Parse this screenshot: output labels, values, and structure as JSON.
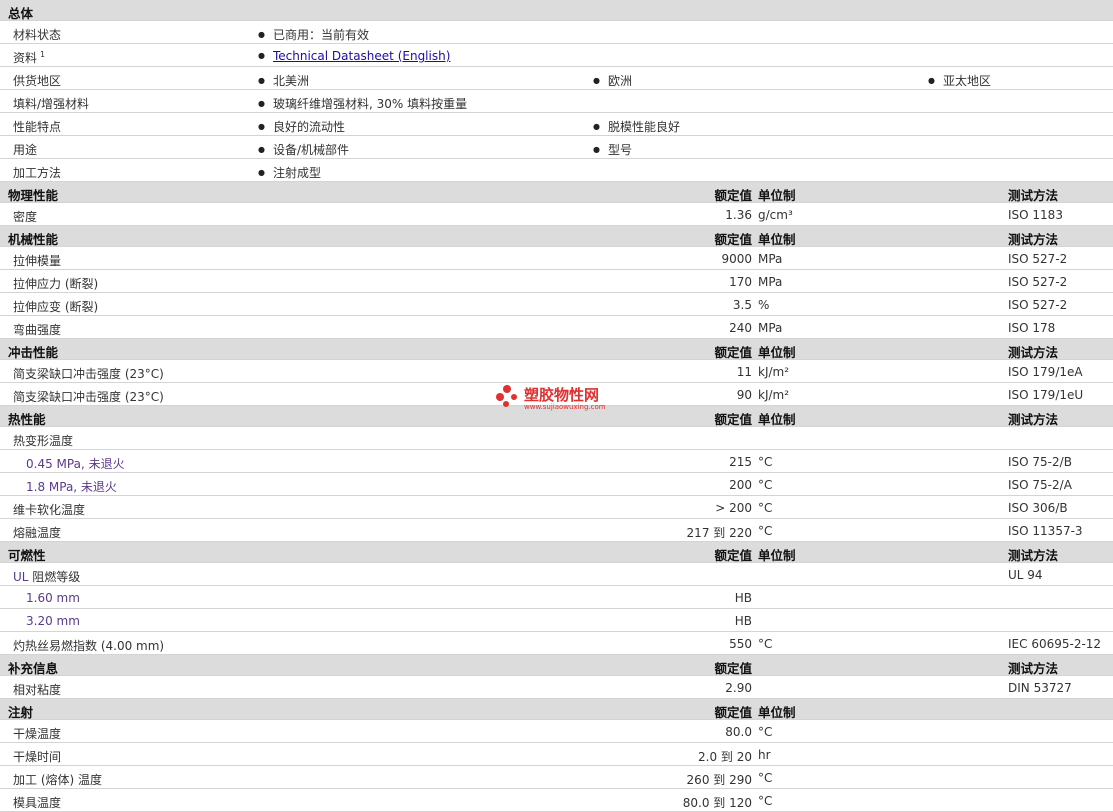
{
  "general": {
    "title": "总体",
    "rows": [
      {
        "label": "材料状态",
        "vals": [
          "已商用：当前有效"
        ]
      },
      {
        "label": "资料",
        "sup": "1",
        "vals": [
          "Technical Datasheet (English)"
        ],
        "link": true
      },
      {
        "label": "供货地区",
        "vals": [
          "北美洲",
          "欧洲",
          "亚太地区"
        ]
      },
      {
        "label": "填料/增强材料",
        "vals": [
          "玻璃纤维增强材料, 30% 填料按重量"
        ]
      },
      {
        "label": "性能特点",
        "vals": [
          "良好的流动性",
          "脱模性能良好"
        ]
      },
      {
        "label": "用途",
        "vals": [
          "设备/机械部件",
          "型号"
        ]
      },
      {
        "label": "加工方法",
        "vals": [
          "注射成型"
        ]
      }
    ]
  },
  "col_headers": {
    "nominal": "额定值",
    "unit": "单位制",
    "method": "测试方法"
  },
  "sections": [
    {
      "title": "物理性能",
      "show_unit": true,
      "rows": [
        {
          "label": "密度",
          "value": "1.36",
          "unit": "g/cm³",
          "method": "ISO 1183"
        }
      ]
    },
    {
      "title": "机械性能",
      "show_unit": true,
      "rows": [
        {
          "label": "拉伸模量",
          "value": "9000",
          "unit": "MPa",
          "method": "ISO 527-2"
        },
        {
          "label": "拉伸应力 (断裂)",
          "value": "170",
          "unit": "MPa",
          "method": "ISO 527-2"
        },
        {
          "label": "拉伸应变 (断裂)",
          "value": "3.5",
          "unit": "%",
          "method": "ISO 527-2"
        },
        {
          "label": "弯曲强度",
          "value": "240",
          "unit": "MPa",
          "method": "ISO 178"
        }
      ]
    },
    {
      "title": "冲击性能",
      "show_unit": true,
      "rows": [
        {
          "label": "简支梁缺口冲击强度 (23°C)",
          "value": "11",
          "unit": "kJ/m²",
          "method": "ISO 179/1eA"
        },
        {
          "label": "简支梁缺口冲击强度 (23°C)",
          "value": "90",
          "unit": "kJ/m²",
          "method": "ISO 179/1eU"
        }
      ]
    },
    {
      "title": "热性能",
      "show_unit": true,
      "rows": [
        {
          "label": "热变形温度",
          "value": "",
          "unit": "",
          "method": ""
        },
        {
          "label": "0.45 MPa, 未退火",
          "indent": true,
          "value": "215",
          "unit": "°C",
          "method": "ISO 75-2/B"
        },
        {
          "label": "1.8 MPa, 未退火",
          "indent": true,
          "value": "200",
          "unit": "°C",
          "method": "ISO 75-2/A"
        },
        {
          "label": "维卡软化温度",
          "value": "> 200",
          "unit": "°C",
          "method": "ISO 306/B"
        },
        {
          "label": "熔融温度",
          "value": "217 到 220",
          "unit": "°C",
          "method": "ISO 11357-3"
        }
      ]
    },
    {
      "title": "可燃性",
      "show_unit": true,
      "rows": [
        {
          "label": "UL 阻燃等级",
          "value": "",
          "unit": "",
          "method": "UL 94"
        },
        {
          "label": "1.60 mm",
          "indent": true,
          "value": "HB",
          "unit": "",
          "method": ""
        },
        {
          "label": "3.20 mm",
          "indent": true,
          "value": "HB",
          "unit": "",
          "method": ""
        },
        {
          "label": "灼热丝易燃指数 (4.00 mm)",
          "value": "550",
          "unit": "°C",
          "method": "IEC 60695-2-12"
        }
      ]
    },
    {
      "title": "补充信息",
      "show_unit": false,
      "rows": [
        {
          "label": "相对粘度",
          "value": "2.90",
          "unit": "",
          "method": "DIN 53727"
        }
      ]
    },
    {
      "title": "注射",
      "show_unit": true,
      "no_method": true,
      "rows": [
        {
          "label": "干燥温度",
          "value": "80.0",
          "unit": "°C",
          "method": ""
        },
        {
          "label": "干燥时间",
          "value": "2.0 到 20",
          "unit": "hr",
          "method": ""
        },
        {
          "label": "加工 (熔体) 温度",
          "value": "260 到 290",
          "unit": "°C",
          "method": ""
        },
        {
          "label": "模具温度",
          "value": "80.0 到 120",
          "unit": "°C",
          "method": ""
        }
      ]
    }
  ],
  "watermark": {
    "name": "塑胶物性网",
    "url": "www.sujiaowuxing.com"
  }
}
